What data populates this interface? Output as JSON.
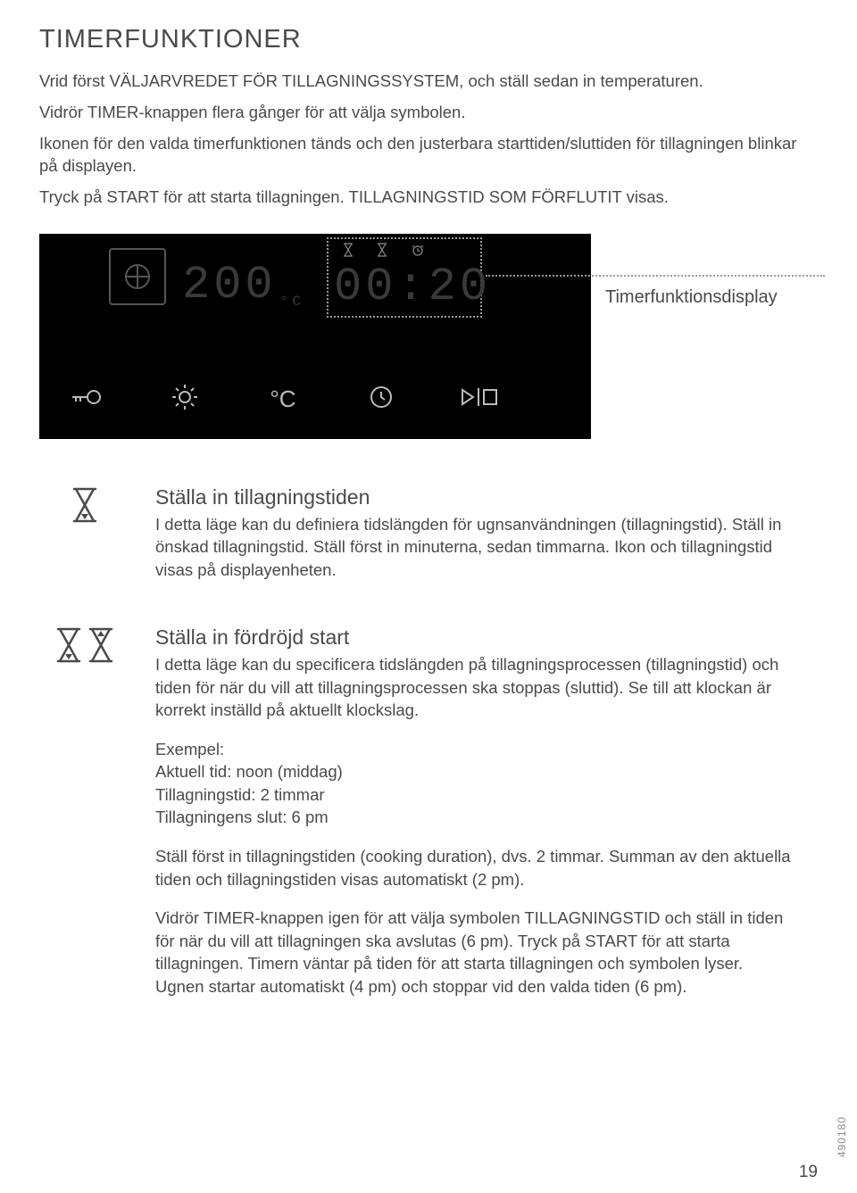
{
  "title": "TIMERFUNKTIONER",
  "intro": [
    "Vrid först VÄLJARVREDET FÖR TILLAGNINGSSYSTEM, och ställ sedan in temperaturen.",
    "Vidrör TIMER-knappen flera gånger för att välja symbolen.",
    "Ikonen för den valda timerfunktionen tänds och den justerbara starttiden/sluttiden för tillagningen blinkar på displayen.",
    "Tryck på START för att starta tillagningen. TILLAGNINGSTID SOM FÖRFLUTIT visas."
  ],
  "display": {
    "temp_value": "200",
    "temp_unit": "°C",
    "time_value": "00:20",
    "callout": "Timerfunktionsdisplay"
  },
  "section1": {
    "title": "Ställa in tillagningstiden",
    "body": "I detta läge kan du definiera tidslängden för ugnsanvändningen (tillagningstid). Ställ in önskad tillagningstid. Ställ först in minuterna, sedan timmarna. Ikon och tillagningstid visas på displayenheten."
  },
  "section2": {
    "title": "Ställa in fördröjd start",
    "body1": "I detta läge kan du specificera tidslängden på tillagningsprocessen (tillagningstid) och tiden för när du vill att tillagningsprocessen ska stoppas (sluttid). Se till att klockan är korrekt inställd på aktuellt klockslag.",
    "example_label": "Exempel:",
    "example_line1": "Aktuell tid: noon (middag)",
    "example_line2": "Tillagningstid: 2 timmar",
    "example_line3": "Tillagningens slut: 6 pm",
    "body2": "Ställ först in tillagningstiden (cooking duration), dvs. 2 timmar. Summan av den aktuella tiden och tillagningstiden visas automatiskt (2 pm).",
    "body3": "Vidrör TIMER-knappen igen för att välja symbolen TILLAGNINGSTID och ställ in tiden för när du vill att tillagningen ska avslutas (6 pm). Tryck på START för att starta tillagningen. Timern väntar på tiden för att starta tillagningen och symbolen lyser. Ugnen startar automatiskt (4 pm) och stoppar vid den valda tiden (6 pm)."
  },
  "page_number": "19",
  "doc_id": "490180"
}
